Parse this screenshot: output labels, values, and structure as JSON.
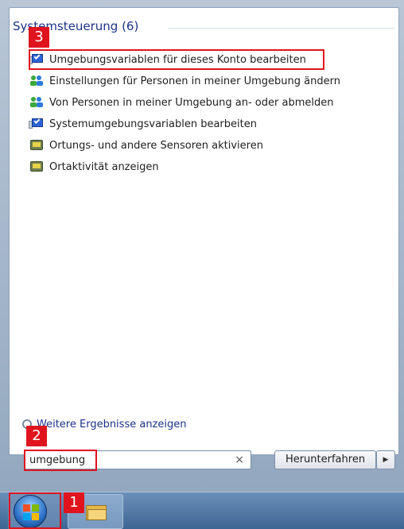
{
  "start_menu": {
    "section_title": "Systemsteuerung (6)",
    "results": [
      {
        "label": "Umgebungsvariablen für dieses Konto bearbeiten",
        "icon": "monitor-shield-icon"
      },
      {
        "label": "Einstellungen für Personen in meiner Umgebung ändern",
        "icon": "people-near-me-icon"
      },
      {
        "label": "Von Personen in meiner Umgebung an- oder abmelden",
        "icon": "people-near-me-icon"
      },
      {
        "label": "Systemumgebungsvariablen bearbeiten",
        "icon": "monitor-shield-icon"
      },
      {
        "label": "Ortungs- und andere Sensoren aktivieren",
        "icon": "sensor-icon"
      },
      {
        "label": "Ortaktivität anzeigen",
        "icon": "sensor-icon"
      }
    ],
    "more_results": "Weitere Ergebnisse anzeigen",
    "search": {
      "value": "umgebung",
      "clear": "×"
    },
    "shutdown_label": "Herunterfahren",
    "shutdown_arrow": "▶"
  },
  "annotations": {
    "badge_1": "1",
    "badge_2": "2",
    "badge_3": "3",
    "color": "#e0141e"
  },
  "taskbar": {
    "start_icon": "windows-start-orb-icon",
    "pinned": [
      "folder-icon"
    ]
  }
}
